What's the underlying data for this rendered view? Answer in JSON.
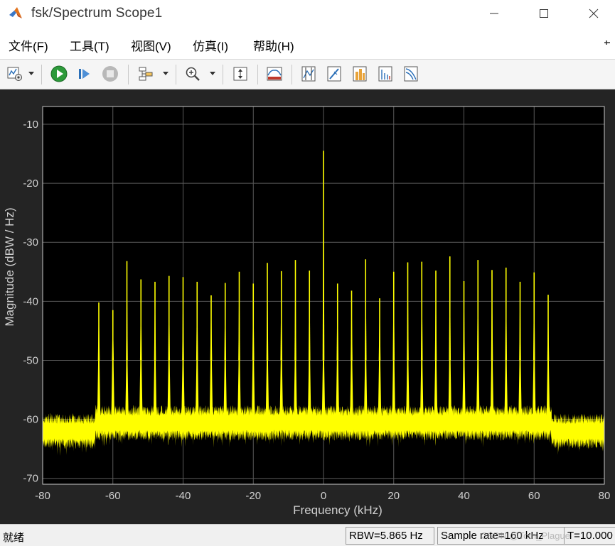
{
  "window": {
    "title": "fsk/Spectrum Scope1"
  },
  "menu": [
    "文件(F)",
    "工具(T)",
    "视图(V)",
    "仿真(I)",
    "帮助(H)"
  ],
  "toolbar": {
    "icons": [
      "scope-settings-icon",
      "run-icon",
      "step-forward-icon",
      "stop-icon",
      "signal-routing-icon",
      "zoom-icon",
      "autoscale-icon",
      "spectrum-settings-icon",
      "cursor-measurements-icon",
      "peak-finder-icon",
      "channel-measurements-icon",
      "distortion-measurements-icon",
      "ccdf-measurements-icon"
    ]
  },
  "status": {
    "ready": "就绪",
    "rbw": "RBW=5.865 Hz",
    "sample_rate": "Sample rate=160 kHz",
    "time": "T=10.000",
    "watermark": "CSDN @Tom_Plague"
  },
  "colors": {
    "trace": "#ffff00",
    "plot_background": "#000000",
    "figure_background": "#242424",
    "grid": "#5a5a5a",
    "tick_text": "#d0d0d0"
  },
  "chart_data": {
    "type": "line",
    "xlabel": "Frequency (kHz)",
    "ylabel": "Magnitude (dBW / Hz)",
    "xlim": [
      -80,
      80
    ],
    "ylim": [
      -71,
      -7
    ],
    "xticks": [
      "-80",
      "-60",
      "-40",
      "-20",
      "0",
      "20",
      "40",
      "60",
      "80"
    ],
    "yticks": [
      "-10",
      "-20",
      "-30",
      "-40",
      "-50",
      "-60",
      "-70"
    ],
    "grid": true,
    "noise_floor": -62,
    "noise_band": [
      -65,
      -59
    ],
    "peak_skirt_base": -60,
    "signal_band": [
      -65,
      65
    ],
    "peaks": {
      "x": [
        -64,
        -60,
        -56,
        -52,
        -48,
        -44,
        -40,
        -36,
        -32,
        -28,
        -24,
        -20,
        -16,
        -12,
        -8,
        -4,
        0,
        4,
        8,
        12,
        16,
        20,
        24,
        28,
        32,
        36,
        40,
        44,
        48,
        52,
        56,
        60,
        64
      ],
      "y": [
        -40.2,
        -41.5,
        -33.2,
        -36.3,
        -36.7,
        -35.7,
        -35.9,
        -36.7,
        -39.0,
        -36.9,
        -35.0,
        -37.0,
        -33.5,
        -34.9,
        -33.0,
        -34.8,
        -14.5,
        -37.0,
        -38.2,
        -32.9,
        -39.5,
        -35.0,
        -33.4,
        -33.3,
        -34.8,
        -32.4,
        -36.6,
        -33.0,
        -34.7,
        -34.3,
        -36.7,
        -35.1,
        -38.9
      ]
    }
  }
}
